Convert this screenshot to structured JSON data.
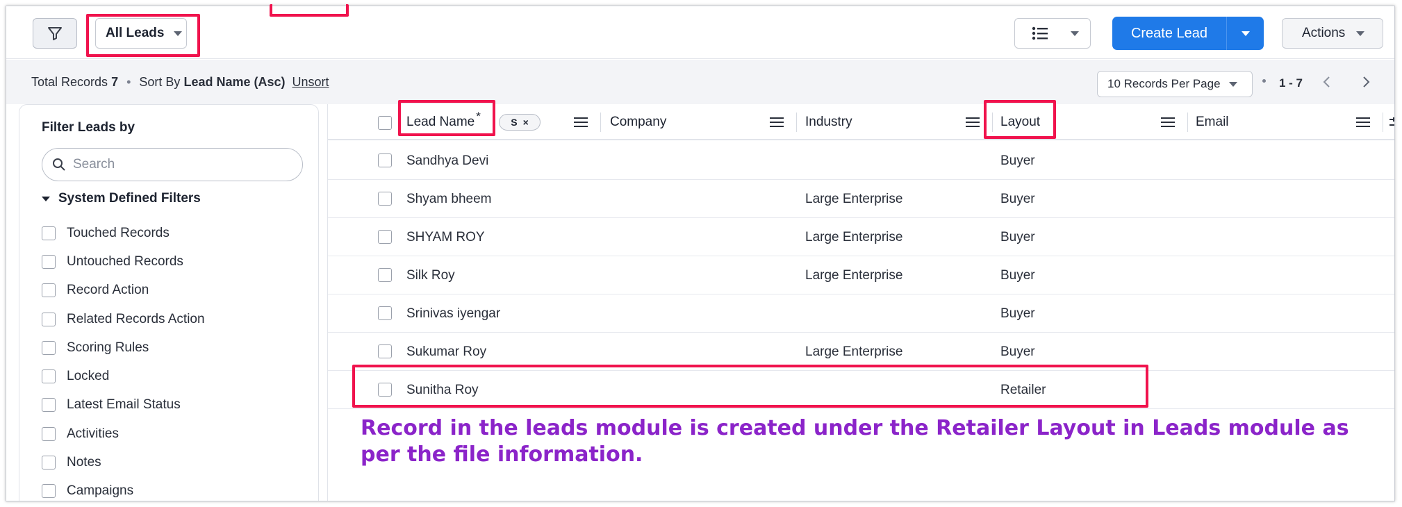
{
  "toolbar": {
    "filter_icon": "filter-icon",
    "view_label": "All Leads",
    "create_label": "Create Lead",
    "actions_label": "Actions"
  },
  "subbar": {
    "total_label": "Total Records",
    "total_value": "7",
    "sort_label": "Sort By",
    "sort_value": "Lead Name (Asc)",
    "unsort_label": "Unsort",
    "per_page": "10 Records Per Page",
    "range": "1 - 7"
  },
  "sidebar": {
    "title": "Filter Leads by",
    "search_placeholder": "Search",
    "section_title": "System Defined Filters",
    "filters": [
      "Touched Records",
      "Untouched Records",
      "Record Action",
      "Related Records Action",
      "Scoring Rules",
      "Locked",
      "Latest Email Status",
      "Activities",
      "Notes",
      "Campaigns"
    ]
  },
  "table": {
    "columns": {
      "lead_name": "Lead Name",
      "sort_mark": "*",
      "chip_label": "S",
      "chip_close": "×",
      "company": "Company",
      "industry": "Industry",
      "layout": "Layout",
      "email": "Email"
    },
    "rows": [
      {
        "lead_name": "Sandhya Devi",
        "company": "",
        "industry": "",
        "layout": "Buyer",
        "email": ""
      },
      {
        "lead_name": "Shyam bheem",
        "company": "",
        "industry": "Large Enterprise",
        "layout": "Buyer",
        "email": ""
      },
      {
        "lead_name": "SHYAM ROY",
        "company": "",
        "industry": "Large Enterprise",
        "layout": "Buyer",
        "email": ""
      },
      {
        "lead_name": "Silk Roy",
        "company": "",
        "industry": "Large Enterprise",
        "layout": "Buyer",
        "email": ""
      },
      {
        "lead_name": "Srinivas iyengar",
        "company": "",
        "industry": "",
        "layout": "Buyer",
        "email": ""
      },
      {
        "lead_name": "Sukumar Roy",
        "company": "",
        "industry": "Large Enterprise",
        "layout": "Buyer",
        "email": ""
      },
      {
        "lead_name": "Sunitha Roy",
        "company": "",
        "industry": "",
        "layout": "Retailer",
        "email": ""
      }
    ]
  },
  "annotation": {
    "text": "Record in the leads module is created under the Retailer Layout in Leads module as per the file information.",
    "color": "#8b24c9",
    "highlight_color": "#f0134d"
  },
  "colors": {
    "primary_button": "#1f7ae8"
  }
}
